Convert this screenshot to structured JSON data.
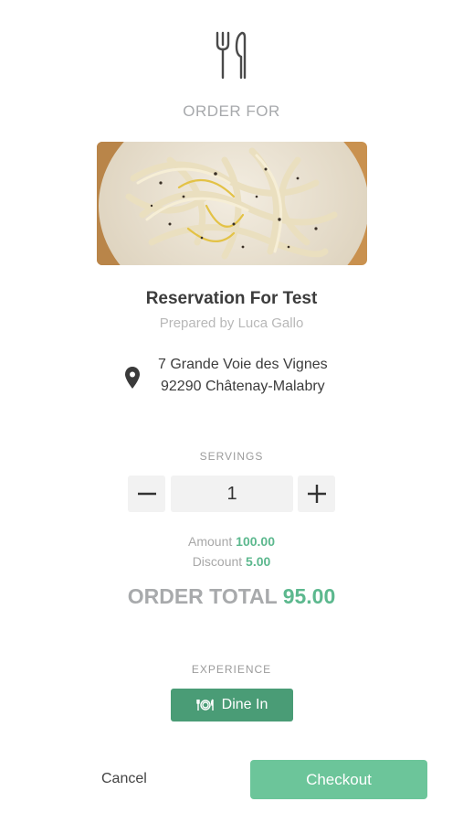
{
  "header": {
    "icon": "fork-knife-icon",
    "label": "ORDER FOR"
  },
  "reservation": {
    "image": "pasta-dish-photo",
    "title": "Reservation For Test",
    "subtitle": "Prepared by Luca Gallo",
    "address_line1": "7 Grande Voie des Vignes",
    "address_line2": "92290 Châtenay-Malabry",
    "address_icon": "location-pin-icon"
  },
  "servings": {
    "label": "SERVINGS",
    "quantity": "1"
  },
  "pricing": {
    "amount_label": "Amount",
    "amount_value": "100.00",
    "discount_label": "Discount",
    "discount_value": "5.00",
    "total_label": "ORDER TOTAL",
    "total_value": "95.00"
  },
  "experience": {
    "label": "EXPERIENCE",
    "option_label": "Dine In",
    "option_icon": "plate-cutlery-icon"
  },
  "actions": {
    "cancel_label": "Cancel",
    "checkout_label": "Checkout"
  },
  "colors": {
    "accent_green": "#5cb88e",
    "dine_in_bg": "#4a9c76",
    "checkout_bg": "#6cc59a"
  }
}
